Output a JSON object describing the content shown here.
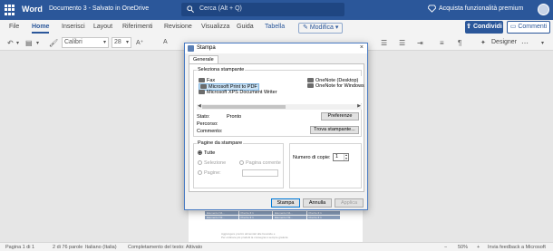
{
  "titlebar": {
    "app": "Word",
    "document": "Documento 3 - Salvato in OneDrive",
    "search_placeholder": "Cerca (Alt + Q)",
    "premium": "Acquista funzionalità premium"
  },
  "ribbon": {
    "tabs": [
      "File",
      "Home",
      "Inserisci",
      "Layout",
      "Riferimenti",
      "Revisione",
      "Visualizza",
      "Guida",
      "Tabella"
    ],
    "active_tab": "Home",
    "edit_label": "Modifica",
    "share_label": "Condividi",
    "comments_label": "Commenti"
  },
  "toolbar": {
    "font": "Calibri",
    "size": "28",
    "designer": "Designer"
  },
  "document": {
    "table_rows": [
      [
        "Elemento N5...",
        "Prezzo € 1",
        "Elemento N5...",
        "Prezzo € 1"
      ],
      [
        "Elemento N4...",
        "Prezzo € 1",
        "Elemento N4...",
        "Prezzo € 1"
      ],
      [
        "Elemento N3...",
        "Prezzo € 1",
        "Elemento N3...",
        "Prezzo € 1"
      ]
    ],
    "footer_line1": "Aggiungere prezzo alimentari alle bevande e",
    "footer_line2": "Per ordinare più prodotti la consegna è sempre gratuita"
  },
  "statusbar": {
    "page": "Pagina 1 di 1",
    "words": "2 di 76 parole",
    "language": "Italiano (Italia)",
    "autocomplete": "Completamento del testo: Attivato",
    "zoom": "50%",
    "feedback": "Invia feedback a Microsoft"
  },
  "dialog": {
    "title": "Stampa",
    "close": "×",
    "tab": "Generale",
    "select_printer_label": "Seleziona stampante",
    "printers_left": [
      "Fax",
      "Microsoft Print to PDF",
      "Microsoft XPS Document Writer"
    ],
    "printers_right": [
      "OneNote (Desktop)",
      "OneNote for Windows"
    ],
    "status_label": "Stato:",
    "status_value": "Pronto",
    "path_label": "Percorso:",
    "comment_label": "Commento:",
    "preferences_button": "Preferenze",
    "find_printer_button": "Trova stampante...",
    "pages_label": "Pagine da stampare",
    "radio_all": "Tutte",
    "radio_selection": "Selezione",
    "radio_current": "Pagina corrente",
    "radio_pages": "Pagine:",
    "copies_label": "Numero di copie:",
    "copies_value": "1",
    "print_button": "Stampa",
    "cancel_button": "Annulla",
    "apply_button": "Applica"
  },
  "colors": {
    "brand": "#2b579a",
    "selection": "#cce4f7"
  }
}
